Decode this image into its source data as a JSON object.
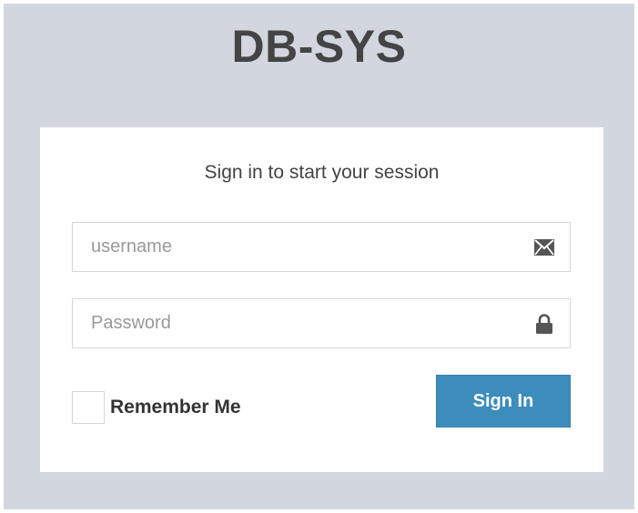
{
  "app": {
    "logo_text": "DB-SYS"
  },
  "login": {
    "message": "Sign in to start your session",
    "username": {
      "placeholder": "username",
      "value": "",
      "icon": "envelope-icon"
    },
    "password": {
      "placeholder": "Password",
      "value": "",
      "icon": "lock-icon"
    },
    "remember_label": "Remember Me",
    "remember_checked": false,
    "submit_label": "Sign In"
  },
  "colors": {
    "page_background": "#d2d6de",
    "primary_button": "#3c8dbc",
    "text": "#444444"
  }
}
